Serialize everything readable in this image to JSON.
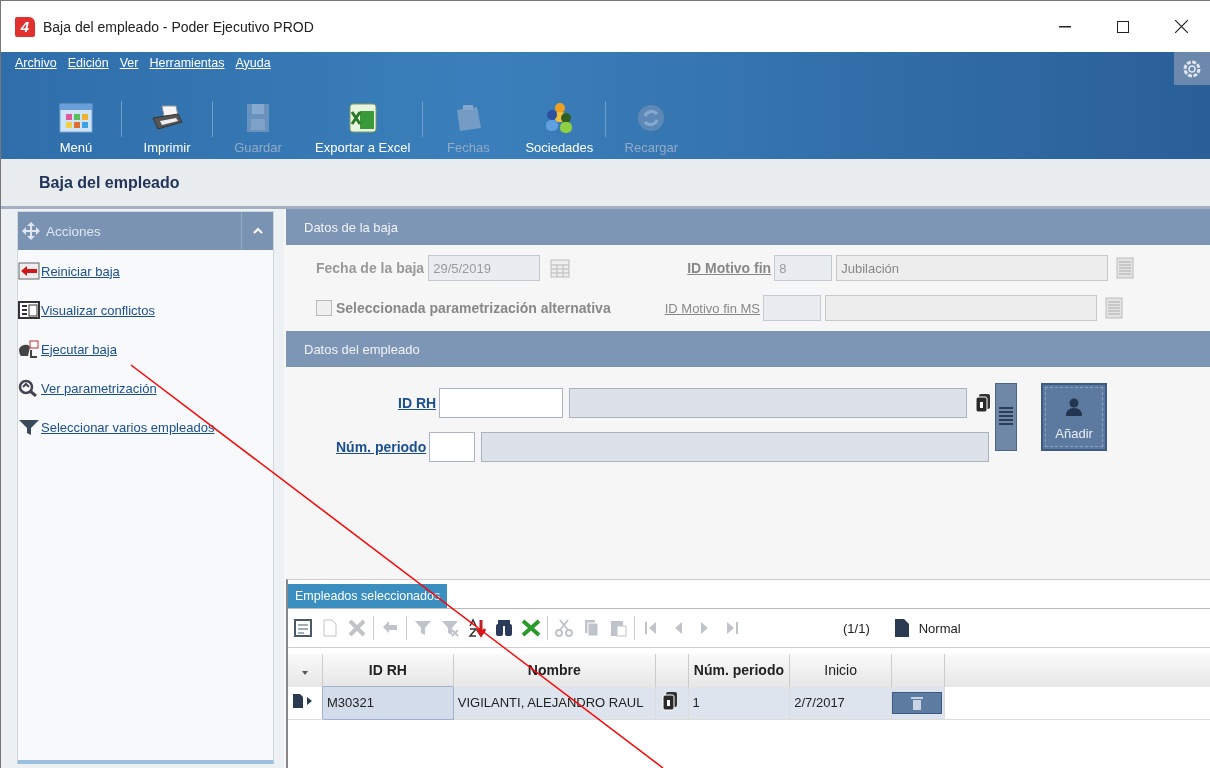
{
  "window": {
    "logo": "4",
    "title": "Baja del empleado - Poder Ejecutivo PROD"
  },
  "menu": [
    "Archivo",
    "Edición",
    "Ver",
    "Herramientas",
    "Ayuda"
  ],
  "toolbar": [
    {
      "kind": "button",
      "label": "Menú",
      "disabled": false
    },
    {
      "kind": "separator"
    },
    {
      "kind": "button",
      "label": "Imprimir",
      "disabled": false
    },
    {
      "kind": "separator"
    },
    {
      "kind": "button",
      "label": "Guardar",
      "disabled": true
    },
    {
      "kind": "button",
      "label": "Exportar a Excel",
      "disabled": false
    },
    {
      "kind": "separator"
    },
    {
      "kind": "button",
      "label": "Fechas",
      "disabled": true
    },
    {
      "kind": "button",
      "label": "Sociedades",
      "disabled": false
    },
    {
      "kind": "separator"
    },
    {
      "kind": "button",
      "label": "Recargar",
      "disabled": true
    }
  ],
  "page_title": "Baja del empleado",
  "actions": {
    "title": "Acciones",
    "expanded": true,
    "items": [
      {
        "label": "Reiniciar baja"
      },
      {
        "label": "Visualizar conflictos"
      },
      {
        "label": "Ejecutar baja"
      },
      {
        "label": "Ver parametrización"
      },
      {
        "label": "Seleccionar varios empleados"
      }
    ]
  },
  "baja": {
    "title": "Datos de la baja",
    "fecha": {
      "label": "Fecha de la baja",
      "value": "29/5/2019",
      "disabled": true
    },
    "motivo": {
      "label": "ID Motivo fin",
      "code": "8",
      "description": "Jubilación",
      "disabled": true
    },
    "alternativa": {
      "label": "Seleccionada parametrización alternativa",
      "checked": false,
      "disabled": true
    },
    "motivo_ms": {
      "label": "ID Motivo fin MS",
      "disabled": true
    }
  },
  "empleado": {
    "title": "Datos del empleado",
    "id_rh": {
      "label": "ID RH"
    },
    "periodo": {
      "label": "Núm. periodo"
    },
    "add_button": "Añadir"
  },
  "grid": {
    "tab": "Empleados seleccionados",
    "counter": "(1/1)",
    "view": "Normal",
    "tools": [
      {
        "kind": "tool",
        "disabled": false
      },
      {
        "kind": "tool",
        "disabled": true
      },
      {
        "kind": "tool",
        "disabled": true
      },
      {
        "kind": "separator"
      },
      {
        "kind": "tool",
        "disabled": true
      },
      {
        "kind": "separator"
      },
      {
        "kind": "tool",
        "disabled": true
      },
      {
        "kind": "tool",
        "disabled": true
      },
      {
        "kind": "tool",
        "disabled": false
      },
      {
        "kind": "tool",
        "disabled": false
      },
      {
        "kind": "tool",
        "disabled": false
      },
      {
        "kind": "separator"
      },
      {
        "kind": "tool",
        "disabled": true
      },
      {
        "kind": "tool",
        "disabled": true
      },
      {
        "kind": "tool",
        "disabled": true
      },
      {
        "kind": "separator"
      },
      {
        "kind": "tool",
        "disabled": true
      },
      {
        "kind": "tool",
        "disabled": true
      },
      {
        "kind": "tool",
        "disabled": true
      },
      {
        "kind": "tool",
        "disabled": true
      }
    ],
    "columns": [
      {
        "label": "ID RH",
        "bold": true
      },
      {
        "label": "Nombre",
        "bold": true
      },
      {
        "label": "Núm. periodo",
        "bold": true
      },
      {
        "label": "Inicio",
        "bold": false
      }
    ],
    "rows": [
      {
        "selected": true,
        "id_rh": "M30321",
        "nombre": "VIGILANTI, ALEJANDRO RAUL",
        "periodo": "1",
        "inicio": "2/7/2017"
      }
    ]
  }
}
